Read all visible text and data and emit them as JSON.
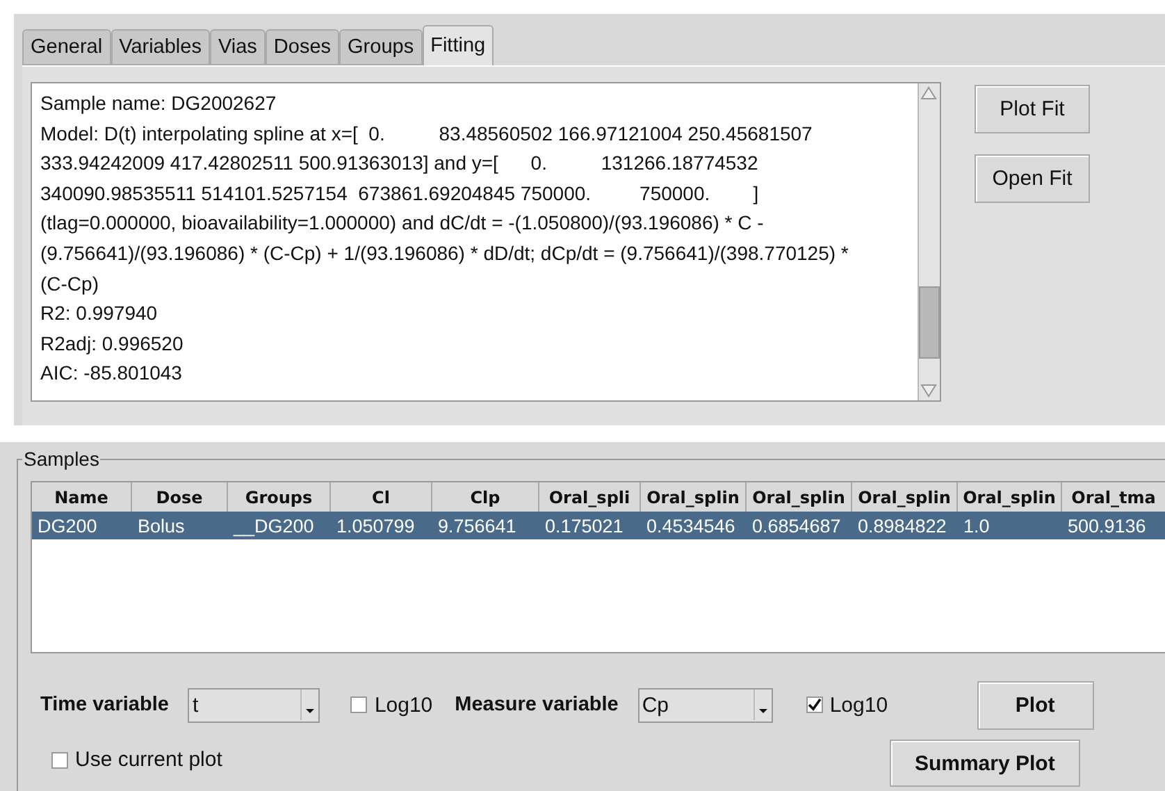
{
  "tabs": [
    {
      "label": "General",
      "selected": false
    },
    {
      "label": "Variables",
      "selected": false
    },
    {
      "label": "Vias",
      "selected": false
    },
    {
      "label": "Doses",
      "selected": false
    },
    {
      "label": "Groups",
      "selected": false
    },
    {
      "label": "Fitting",
      "selected": true
    }
  ],
  "fit_report": {
    "lines": [
      "Sample name: DG2002627",
      "Model: D(t) interpolating spline at x=[  0.          83.48560502 166.97121004 250.45681507",
      "333.94242009 417.42802511 500.91363013] and y=[      0.          131266.18774532",
      "340090.98535511 514101.5257154  673861.69204845 750000.         750000.        ]",
      "(tlag=0.000000, bioavailability=1.000000) and dC/dt = -(1.050800)/(93.196086) * C -",
      "(9.756641)/(93.196086) * (C-Cp) + 1/(93.196086) * dD/dt; dCp/dt = (9.756641)/(398.770125) *",
      "(C-Cp)",
      "R2: 0.997940",
      "R2adj: 0.996520",
      "AIC: -85.801043"
    ]
  },
  "fit_buttons": [
    "Plot Fit",
    "Open Fit"
  ],
  "samples": {
    "title": "Samples",
    "columns": [
      "Name",
      "Dose",
      "Groups",
      "Cl",
      "Clp",
      "Oral_spli",
      "Oral_splin",
      "Oral_splin",
      "Oral_splin",
      "Oral_splin",
      "Oral_tma"
    ],
    "rows": [
      {
        "selected": true,
        "cells": [
          "DG200",
          "Bolus",
          "__DG200",
          "1.050799",
          "9.756641",
          "0.175021",
          "0.4534546",
          "0.6854687",
          "0.8984822",
          "1.0",
          "500.9136"
        ]
      }
    ]
  },
  "time_variable": {
    "label": "Time variable",
    "value": "t",
    "log10": {
      "label": "Log10",
      "checked": false
    }
  },
  "measure_variable": {
    "label": "Measure variable",
    "value": "Cp",
    "log10": {
      "label": "Log10",
      "checked": true
    }
  },
  "use_current_plot": {
    "label": "Use current plot",
    "checked": false
  },
  "plot_buttons": [
    "Plot",
    "Summary Plot"
  ]
}
